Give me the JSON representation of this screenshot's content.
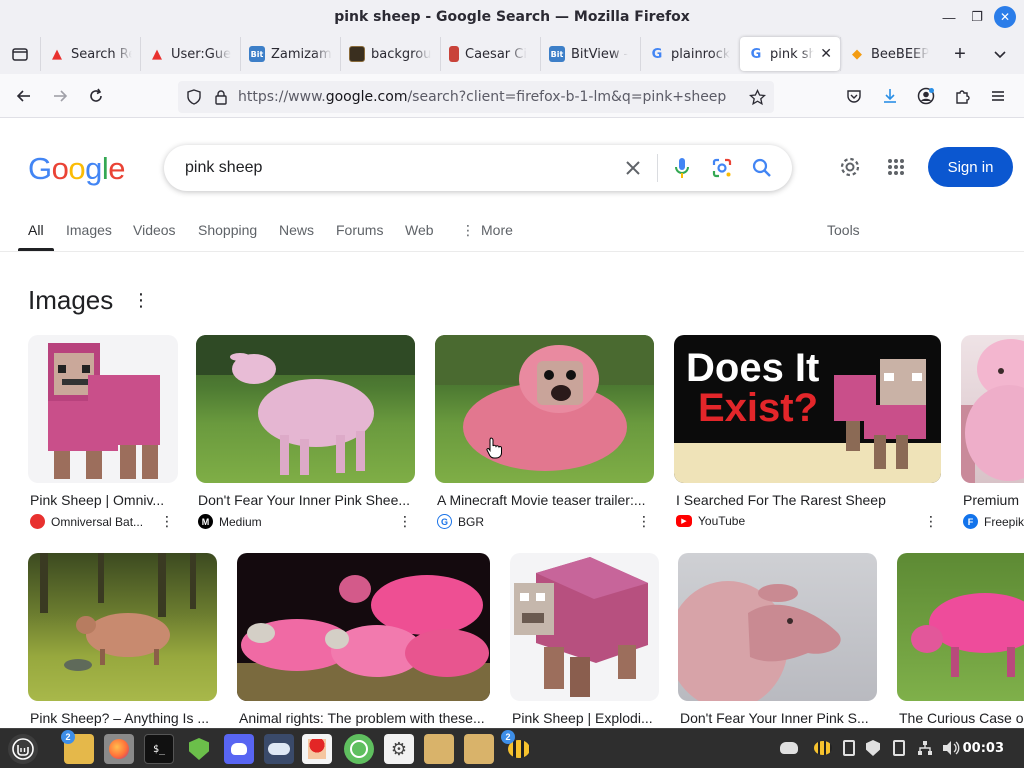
{
  "window": {
    "title": "pink sheep - Google Search — Mozilla Firefox"
  },
  "tabs": [
    {
      "label": "Search Re",
      "icon": "flame-icon",
      "color": "#e8312f"
    },
    {
      "label": "User:Gue",
      "icon": "flame-icon",
      "color": "#e8312f"
    },
    {
      "label": "Zamizam",
      "icon": "bitview-icon",
      "color": "#3d7fc8"
    },
    {
      "label": "backgrou",
      "icon": "image-icon",
      "color": "#6b5b3a"
    },
    {
      "label": "Caesar Ci",
      "icon": "bookmark-icon",
      "color": "#c9433a"
    },
    {
      "label": "BitView -",
      "icon": "bitview-icon",
      "color": "#3d7fc8"
    },
    {
      "label": "plainrock",
      "icon": "google-icon",
      "color": "#4285f4"
    },
    {
      "label": "pink sh",
      "icon": "google-icon",
      "color": "#4285f4",
      "active": true
    },
    {
      "label": "BeeBEEP",
      "icon": "beebeep-icon",
      "color": "#f39c12"
    }
  ],
  "nav": {
    "url_prefix": "https://www.",
    "url_domain": "google.com",
    "url_rest": "/search?client=firefox-b-1-lm&q=pink+sheep"
  },
  "google": {
    "logo_letters": [
      "G",
      "o",
      "o",
      "g",
      "l",
      "e"
    ],
    "query": "pink sheep",
    "signin_label": "Sign in"
  },
  "result_tabs": [
    {
      "label": "All",
      "active": true
    },
    {
      "label": "Images"
    },
    {
      "label": "Videos"
    },
    {
      "label": "Shopping"
    },
    {
      "label": "News"
    },
    {
      "label": "Forums"
    },
    {
      "label": "Web"
    },
    {
      "label": "More"
    },
    {
      "label": "Tools"
    }
  ],
  "images_section": {
    "heading": "Images",
    "row1": [
      {
        "caption": "Pink Sheep | Omniv...",
        "source": "Omniversal Bat...",
        "source_icon_color": "#e8312f",
        "source_icon_text": ""
      },
      {
        "caption": "Don't Fear Your Inner Pink Shee...",
        "source": "Medium",
        "source_icon_color": "#000000",
        "source_icon_text": "M"
      },
      {
        "caption": "A Minecraft Movie teaser trailer:...",
        "source": "BGR",
        "source_icon_color": "#1a73e8",
        "source_icon_text": "G"
      },
      {
        "caption": "I Searched For The Rarest Sheep",
        "source": "YouTube",
        "source_icon_color": "#ff0000",
        "source_icon_text": "▶"
      },
      {
        "caption": "Premium",
        "source": "Freepik",
        "source_icon_color": "#1273eb",
        "source_icon_text": "F"
      }
    ],
    "row2": [
      {
        "caption": "Pink Sheep? – Anything Is ..."
      },
      {
        "caption": "Animal rights: The problem with these..."
      },
      {
        "caption": "Pink Sheep | Explodi..."
      },
      {
        "caption": "Don't Fear Your Inner Pink S..."
      },
      {
        "caption": "The Curious Case o"
      }
    ],
    "youtube_thumb_text_1": "Does It",
    "youtube_thumb_text_2": "Exist?"
  },
  "taskbar": {
    "clock": "00:03",
    "badge_files": "2",
    "badge_beebeep": "2"
  },
  "colors": {
    "accent_blue": "#0b57d0",
    "sheep_pink": "#e88ab5",
    "mc_pink": "#c94f8a"
  }
}
